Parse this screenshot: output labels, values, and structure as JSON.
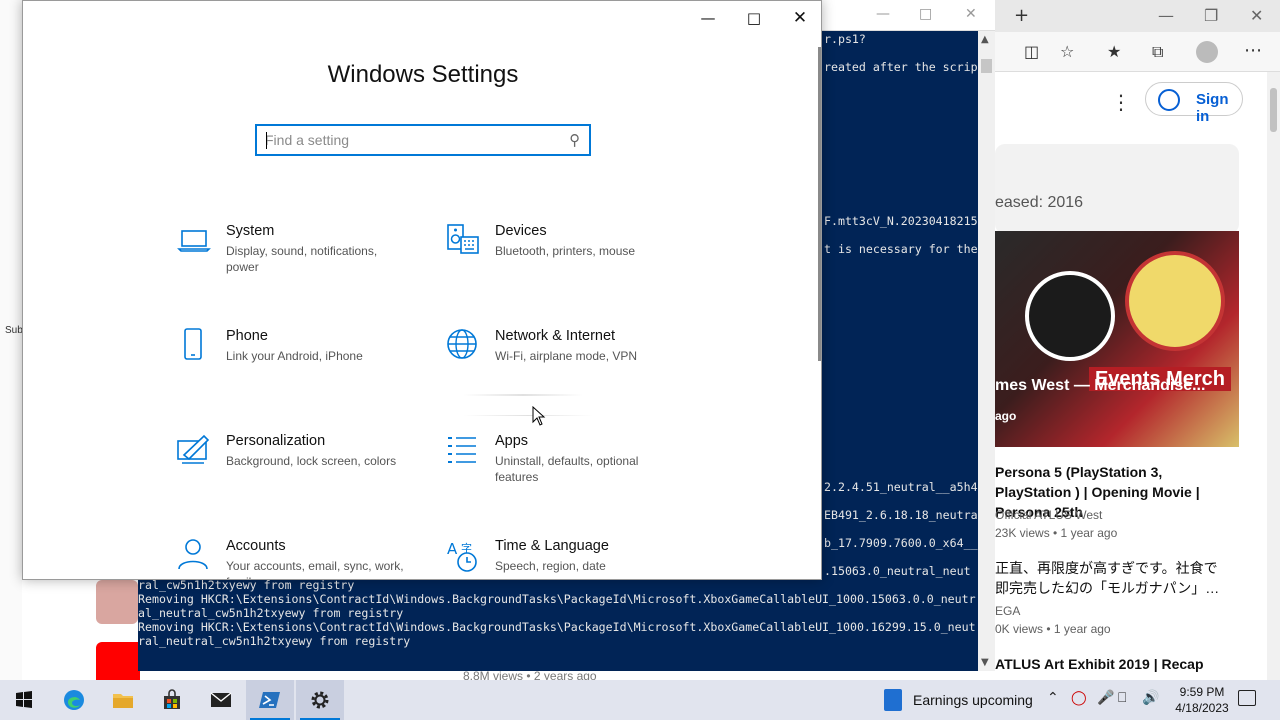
{
  "settings": {
    "title": "Windows Settings",
    "search_placeholder": "Find a setting",
    "tiles": [
      {
        "name": "System",
        "desc": "Display, sound, notifications, power",
        "icon": "laptop-icon"
      },
      {
        "name": "Devices",
        "desc": "Bluetooth, printers, mouse",
        "icon": "keyboard-speaker-icon"
      },
      {
        "name": "Phone",
        "desc": "Link your Android, iPhone",
        "icon": "phone-icon"
      },
      {
        "name": "Network & Internet",
        "desc": "Wi-Fi, airplane mode, VPN",
        "icon": "globe-icon"
      },
      {
        "name": "Personalization",
        "desc": "Background, lock screen, colors",
        "icon": "paint-icon"
      },
      {
        "name": "Apps",
        "desc": "Uninstall, defaults, optional features",
        "icon": "apps-list-icon"
      },
      {
        "name": "Accounts",
        "desc": "Your accounts, email, sync, work, family",
        "icon": "person-icon"
      },
      {
        "name": "Time & Language",
        "desc": "Speech, region, date",
        "icon": "time-language-icon"
      }
    ],
    "accent": "#0078d7"
  },
  "powershell": {
    "lines_top": [
      "r.ps1?",
      "reated after the scrip",
      "F.mtt3cV_N.20230418215",
      "t is necessary for the",
      "2.2.4.51_neutral__a5h4",
      "EB491_2.6.18.18_neutra",
      "b_17.7909.7600.0_x64__",
      ".15063.0_neutral_neut"
    ],
    "lines_bottom": [
      "ral_cw5n1h2txyewy from registry",
      "Removing HKCR:\\Extensions\\ContractId\\Windows.BackgroundTasks\\PackageId\\Microsoft.XboxGameCallableUI_1000.15063.0.0_neutr",
      "al_neutral_cw5n1h2txyewy from registry",
      "Removing HKCR:\\Extensions\\ContractId\\Windows.BackgroundTasks\\PackageId\\Microsoft.XboxGameCallableUI_1000.16299.15.0_neut",
      "ral_neutral_cw5n1h2txyewy from registry"
    ],
    "background": "#012456"
  },
  "browser": {
    "signin_label": "Sign in",
    "released": "eased: 2016",
    "thumb_title": "mes West — Merchandise...",
    "thumb_ago": "ago",
    "thumb_badge": "Events Merch",
    "videos": [
      {
        "title": "Persona 5 (PlayStation 3, PlayStation ) | Opening Movie | Persona 25th",
        "channel": "Official ATLUS West",
        "meta": "23K views • 1 year ago"
      },
      {
        "title": "正直、再限度が高すぎです。社食で 即完売した幻の「モルガナパン」…",
        "channel": "EGA",
        "meta": "0K views • 1 year ago"
      },
      {
        "title": "ATLUS Art Exhibit 2019 | Recap",
        "channel": "",
        "meta": ""
      }
    ],
    "bg_views": "8.8M views • 2 years ago",
    "left_label": "Sub"
  },
  "taskbar": {
    "earnings_label": "Earnings upcoming",
    "time": "9:59 PM",
    "date": "4/18/2023"
  }
}
